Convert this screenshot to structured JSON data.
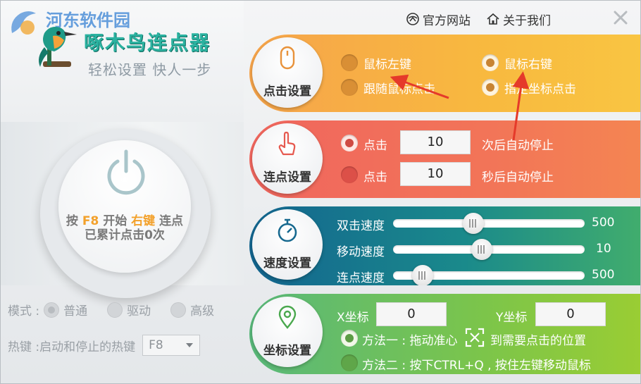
{
  "watermark": {
    "text": "河东软件园"
  },
  "app": {
    "name": "啄木鸟连点器",
    "slogan": "轻松设置 快人一步"
  },
  "header": {
    "official_site": "官方网站",
    "about": "关于我们"
  },
  "power": {
    "line1_prefix": "按",
    "hotkey": "F8",
    "line1_mid": "开始",
    "button": "右键",
    "line1_suffix": "连点",
    "line2": "已累计点击0次"
  },
  "mode": {
    "label": "模式 :",
    "options": [
      "普通",
      "驱动",
      "高级"
    ],
    "selected": 0
  },
  "hotkey": {
    "label": "热键 :启动和停止的热键",
    "value": "F8"
  },
  "click_panel": {
    "title": "点击设置",
    "options": [
      "鼠标左键",
      "鼠标右键",
      "跟随鼠标点击",
      "指定坐标点击"
    ],
    "selected": [
      1,
      3
    ]
  },
  "repeat_panel": {
    "title": "连点设置",
    "row1": {
      "label": "点击",
      "value": "10",
      "suffix": "次后自动停止"
    },
    "row2": {
      "label": "点击",
      "value": "10",
      "suffix": "秒后自动停止"
    },
    "selected": 0
  },
  "speed_panel": {
    "title": "速度设置",
    "sliders": [
      {
        "label": "双击速度",
        "value": "500",
        "level": 0.41
      },
      {
        "label": "移动速度",
        "value": "10",
        "level": 0.46
      },
      {
        "label": "连点速度",
        "value": "500",
        "level": 0.11
      }
    ]
  },
  "coord_panel": {
    "title": "坐标设置",
    "x_label": "X坐标",
    "x_value": "0",
    "y_label": "Y坐标",
    "y_value": "0",
    "method1_prefix": "方法一 : 拖动准心",
    "method1_suffix": "到需要点击的位置",
    "method2": "方法二 : 按下CTRL+Q , 按住左键移动鼠标",
    "selected": 0
  },
  "colors": {
    "accent_orange": "#f3a12b",
    "teal": "#2bb2a0",
    "arrow_red": "#e53a2a"
  },
  "icons": [
    "home-icon",
    "site-icon",
    "close-icon",
    "power-icon",
    "mouse-icon",
    "finger-icon",
    "stopwatch-icon",
    "location-icon",
    "crosshair-icon"
  ]
}
